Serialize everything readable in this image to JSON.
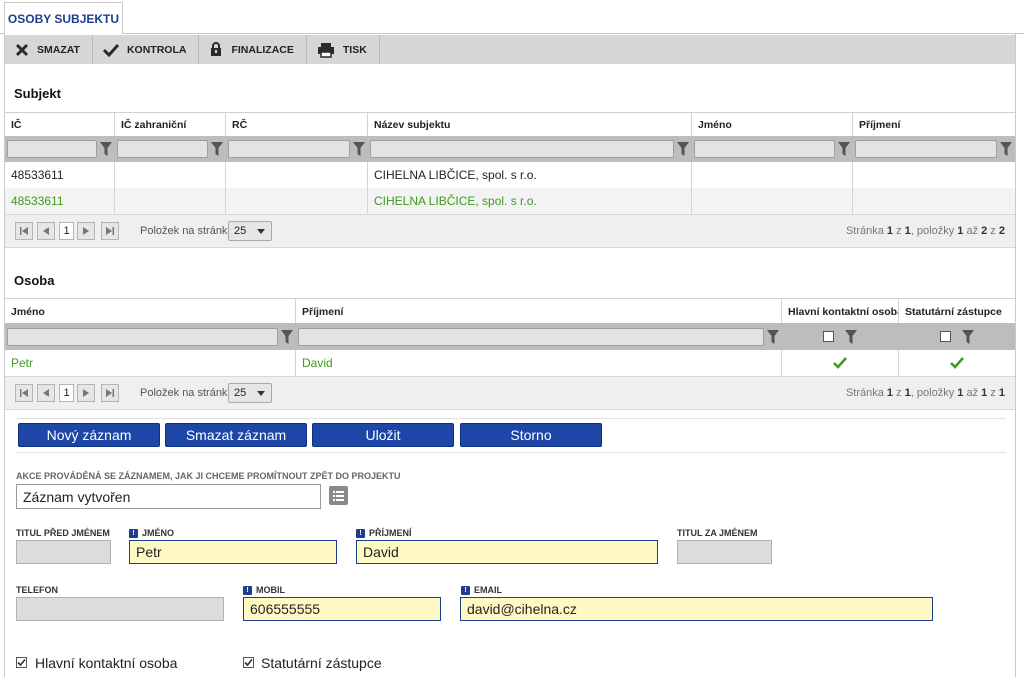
{
  "tab": {
    "label": "OSOBY SUBJEKTU"
  },
  "toolbar": {
    "delete": "SMAZAT",
    "check": "KONTROLA",
    "finalize": "FINALIZACE",
    "print": "TISK"
  },
  "subjekt": {
    "title": "Subjekt",
    "columns": [
      "IČ",
      "IČ zahraniční",
      "RČ",
      "Název subjektu",
      "Jméno",
      "Příjmení"
    ],
    "rows": [
      [
        "48533611",
        "",
        "",
        "CIHELNA LIBČICE, spol. s r.o.",
        "",
        ""
      ],
      [
        "48533611",
        "",
        "",
        "CIHELNA LIBČICE, spol. s r.o.",
        "",
        ""
      ]
    ],
    "pager": {
      "page": "1",
      "per_page_label": "Položek na stránku",
      "per_page": "25",
      "info_prefix": "Stránka ",
      "info_page": "1",
      "info_of": " z ",
      "info_pages": "1",
      "info_items": ", položky ",
      "info_from": "1",
      "info_to_word": " až ",
      "info_to": "2",
      "info_total": "2"
    }
  },
  "osoba": {
    "title": "Osoba",
    "columns": [
      "Jméno",
      "Příjmení",
      "Hlavní kontaktní osoba",
      "Statutární zástupce"
    ],
    "rows": [
      {
        "jmeno": "Petr",
        "prijmeni": "David",
        "hlavni": true,
        "statutarni": true
      }
    ],
    "pager": {
      "page": "1",
      "per_page_label": "Položek na stránku",
      "per_page": "25",
      "info_prefix": "Stránka ",
      "info_page": "1",
      "info_of": " z ",
      "info_pages": "1",
      "info_items": ", položky ",
      "info_from": "1",
      "info_to_word": " až ",
      "info_to": "1",
      "info_total": "1"
    }
  },
  "buttons": {
    "new": "Nový záznam",
    "delete": "Smazat záznam",
    "save": "Uložit",
    "cancel": "Storno"
  },
  "form": {
    "action_label": "AKCE PROVÁDĚNÁ SE ZÁZNAMEM, JAK JI CHCEME PROMÍTNOUT ZPĚT DO PROJEKTU",
    "action_value": "Záznam vytvořen",
    "titul_pred_label": "TITUL PŘED JMÉNEM",
    "titul_pred_value": "",
    "jmeno_label": "JMÉNO",
    "jmeno_value": "Petr",
    "prijmeni_label": "PŘÍJMENÍ",
    "prijmeni_value": "David",
    "titul_za_label": "TITUL ZA JMÉNEM",
    "titul_za_value": "",
    "telefon_label": "TELEFON",
    "telefon_value": "",
    "mobil_label": "MOBIL",
    "mobil_value": "606555555",
    "email_label": "EMAIL",
    "email_value": "david@cihelna.cz",
    "hlavni_label": "Hlavní kontaktní osoba",
    "hlavni_checked": true,
    "statutarni_label": "Statutární zástupce",
    "statutarni_checked": true
  },
  "colors": {
    "accent": "#1d46a6",
    "link_green": "#3f9a1e",
    "required_bg": "#fff9c4"
  }
}
